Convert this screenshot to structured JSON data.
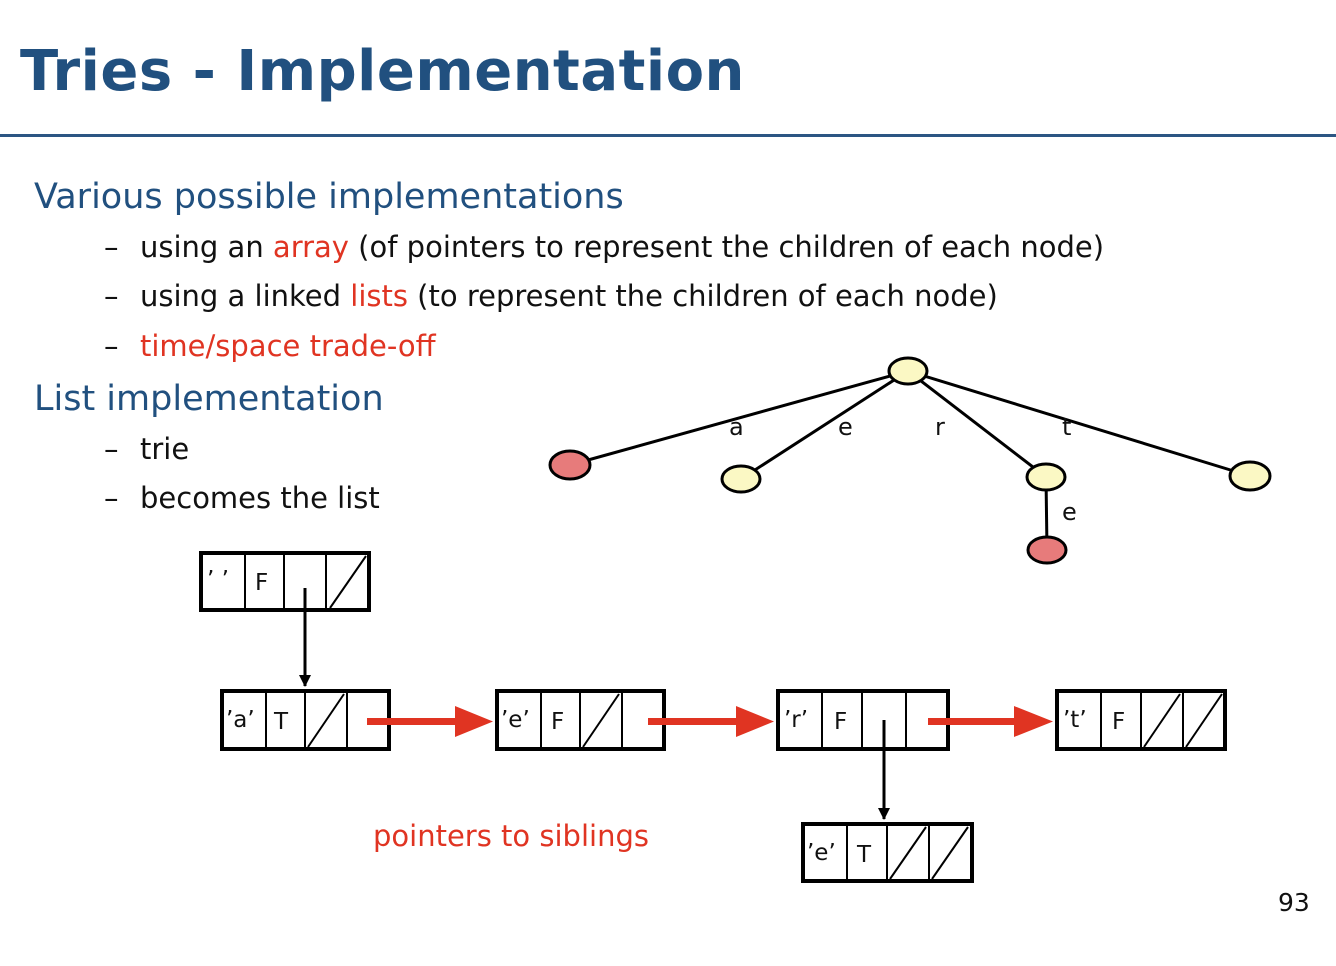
{
  "title": "Tries - Implementation",
  "section1": {
    "heading": "Various possible implementations",
    "items": [
      {
        "pre": "using an ",
        "highlight": "array",
        "post": " (of pointers to represent the children of each node)"
      },
      {
        "pre": "using a linked ",
        "highlight": "lists",
        "post": " (to represent the children of each node)"
      },
      {
        "pre": "",
        "highlight": "time/space trade-off",
        "post": ""
      }
    ]
  },
  "section2": {
    "heading": "List implementation",
    "items": [
      "trie",
      "becomes the list"
    ]
  },
  "bullet_dash": "–",
  "tree": {
    "edge_labels": [
      "a",
      "e",
      "r",
      "t",
      "e"
    ]
  },
  "list_nodes": {
    "root": {
      "char": "’ ’",
      "flag": "F"
    },
    "a": {
      "char": "’a’",
      "flag": "T"
    },
    "e": {
      "char": "’e’",
      "flag": "F"
    },
    "r": {
      "char": "’r’",
      "flag": "F"
    },
    "t": {
      "char": "’t’",
      "flag": "F"
    },
    "re": {
      "char": "’e’",
      "flag": "T"
    }
  },
  "caption": "pointers to siblings",
  "page_number": "93",
  "colors": {
    "title": "#21507f",
    "rule": "#2c5683",
    "highlight": "#e03422",
    "node_fill": "#fbf8c4",
    "terminal_fill": "#e77b7b",
    "arrow_red": "#e03422"
  }
}
